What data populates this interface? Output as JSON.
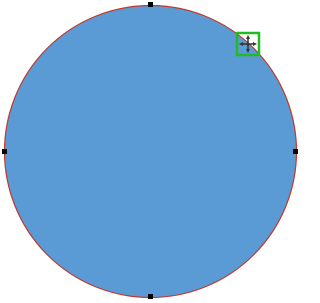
{
  "shape": {
    "kind": "circle",
    "fill_color": "#5b9bd5",
    "outline_color": "#c0392b",
    "selected": true
  },
  "selection_handles": {
    "count": 4,
    "color": "#000000",
    "positions": [
      "top",
      "right",
      "bottom",
      "left"
    ]
  },
  "cursor": {
    "icon": "move-crosshair-icon",
    "highlight_color": "#22bb22",
    "cursor_color": "#333333"
  }
}
